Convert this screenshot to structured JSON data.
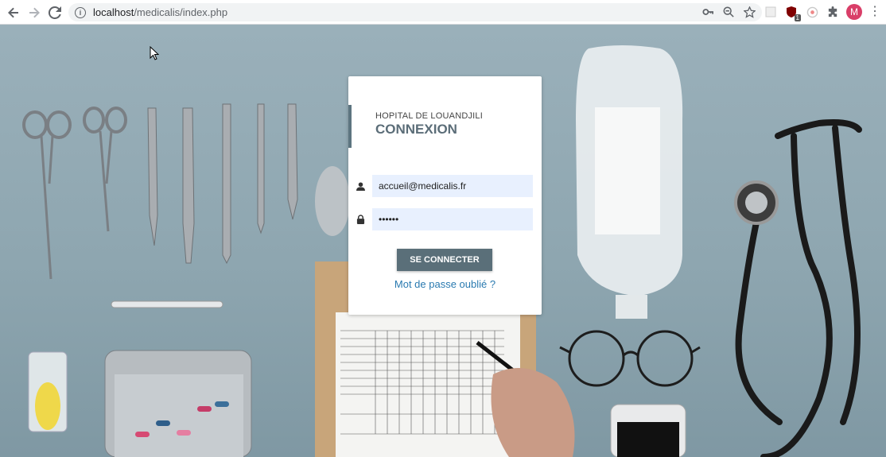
{
  "browser": {
    "url_host": "localhost",
    "url_path": "/medicalis/index.php",
    "profile_initial": "M",
    "extension_badge": "1"
  },
  "login": {
    "hospital_name": "HOPITAL DE LOUANDJILI",
    "heading": "CONNEXION",
    "email_value": "accueil@medicalis.fr",
    "password_value": "••••••",
    "submit_label": "SE CONNECTER",
    "forgot_link": "Mot de passe oublié ?"
  },
  "colors": {
    "accent": "#5a6f79",
    "link": "#2a7ab0",
    "field_bg": "#e8f0fe"
  }
}
